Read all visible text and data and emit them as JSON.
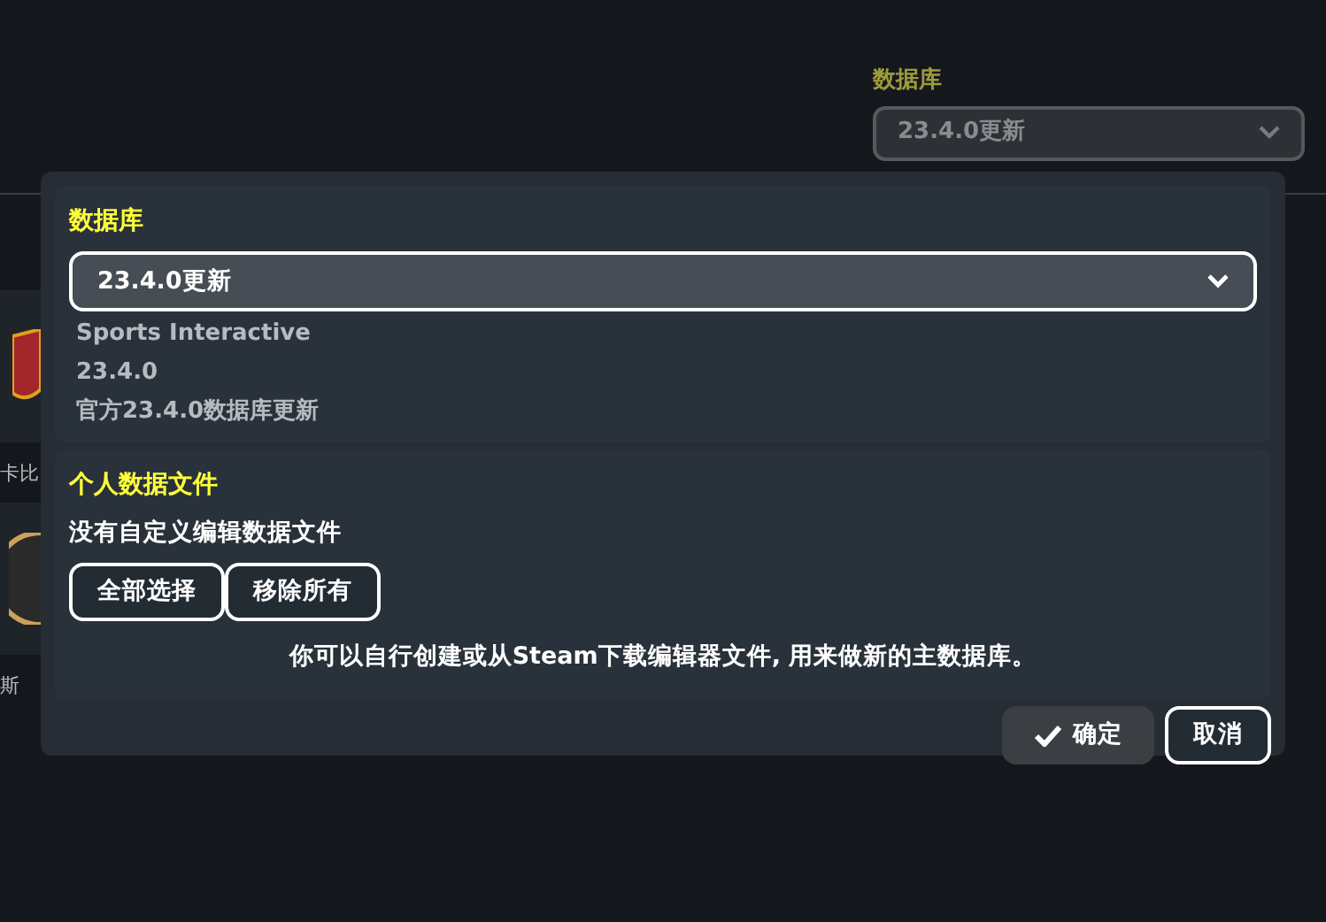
{
  "background": {
    "database_label": "数据库",
    "database_select": "23.4.0更新",
    "side_items": [
      {
        "label": "卡比",
        "kind": "shield"
      },
      {
        "label": "斯",
        "kind": "round"
      }
    ]
  },
  "dialog": {
    "database_section": {
      "title": "数据库",
      "select_value": "23.4.0更新",
      "details": [
        "Sports Interactive",
        "23.4.0",
        "官方23.4.0数据库更新"
      ]
    },
    "personal_section": {
      "title": "个人数据文件",
      "status": "没有自定义编辑数据文件",
      "buttons": [
        "全部选择",
        "移除所有"
      ],
      "note": "你可以自行创建或从Steam下载编辑器文件, 用来做新的主数据库。"
    },
    "actions": [
      {
        "label": "确定",
        "kind": "confirm"
      },
      {
        "label": "取消",
        "kind": "cancel"
      }
    ]
  }
}
